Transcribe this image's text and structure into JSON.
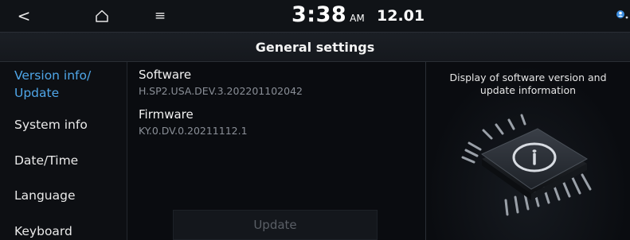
{
  "topbar": {
    "back_icon": "chevron-left-icon",
    "home_icon": "home-icon",
    "menu_icon": "menu-icon",
    "time": "3:38",
    "ampm": "AM",
    "date": "12.01",
    "status_icon": "voice-assistant-icon"
  },
  "header": {
    "title": "General settings"
  },
  "sidebar": {
    "items": [
      {
        "label": "Version info/ Update",
        "active": true
      },
      {
        "label": "System info",
        "active": false
      },
      {
        "label": "Date/Time",
        "active": false
      },
      {
        "label": "Language",
        "active": false
      },
      {
        "label": "Keyboard",
        "active": false
      }
    ]
  },
  "main": {
    "software": {
      "label": "Software",
      "value": "H.SP2.USA.DEV.3.202201102042"
    },
    "firmware": {
      "label": "Firmware",
      "value": "KY.0.DV.0.20211112.1"
    },
    "update_button": "Update"
  },
  "info_panel": {
    "description": "Display of software version and update information",
    "icon": "chip-info-icon"
  },
  "colors": {
    "accent": "#4fa6e8",
    "background": "#0a0c10",
    "disabled_text": "#5a5f66"
  }
}
